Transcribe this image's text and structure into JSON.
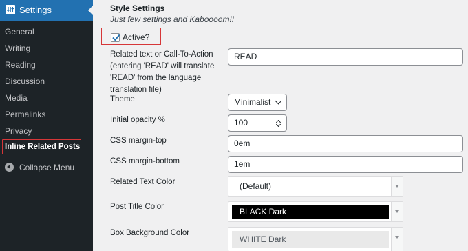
{
  "sidebar": {
    "header": "Settings",
    "items": [
      {
        "label": "General"
      },
      {
        "label": "Writing"
      },
      {
        "label": "Reading"
      },
      {
        "label": "Discussion"
      },
      {
        "label": "Media"
      },
      {
        "label": "Permalinks"
      },
      {
        "label": "Privacy"
      }
    ],
    "active_item": "Inline Related Posts",
    "collapse": "Collapse Menu"
  },
  "main": {
    "title": "Style Settings",
    "subtitle": "Just few settings and Kaboooom!!",
    "active_checkbox": {
      "label": "Active?",
      "checked": true
    },
    "fields": {
      "cta": {
        "label_lines": [
          "Related text or Call-To-Action",
          "(entering 'READ' will translate",
          "'READ' from the language",
          "translation file)"
        ],
        "value": "READ"
      },
      "theme": {
        "label": "Theme",
        "value": "Minimalist"
      },
      "opacity": {
        "label": "Initial opacity %",
        "value": "100"
      },
      "margin_top": {
        "label": "CSS margin-top",
        "value": "0em"
      },
      "margin_bottom": {
        "label": "CSS margin-bottom",
        "value": "1em"
      },
      "text_color": {
        "label": "Related Text Color",
        "value": "(Default)",
        "swatch": "#ffffff",
        "text_color": "#1d2327"
      },
      "title_color": {
        "label": "Post Title Color",
        "value": "BLACK Dark",
        "swatch": "#000000",
        "text_color": "#ffffff"
      },
      "bg_color": {
        "label": "Box Background Color",
        "value": "WHITE Dark",
        "swatch": "#e9e9e9",
        "text_color": "#50575e"
      }
    }
  }
}
